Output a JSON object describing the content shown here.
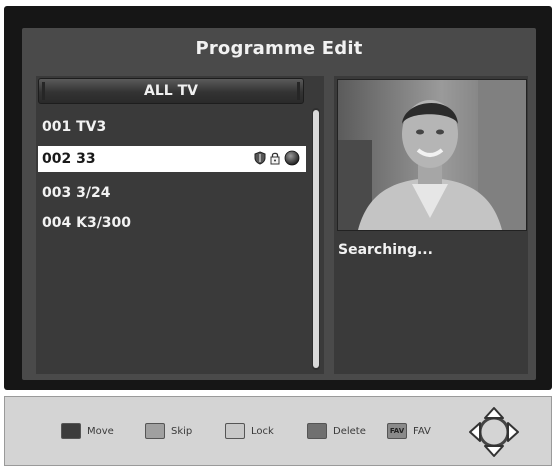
{
  "screen": {
    "title": "Programme Edit"
  },
  "channel_list": {
    "group_label": "ALL TV",
    "selected_index": 1,
    "items": [
      {
        "label": "001 TV3"
      },
      {
        "label": "002 33"
      },
      {
        "label": "003 3/24"
      },
      {
        "label": "004 K3/300"
      }
    ]
  },
  "channel_icons": [
    "shield-icon",
    "lock-icon",
    "globe-icon"
  ],
  "preview": {
    "status": "Searching..."
  },
  "legend": {
    "items": [
      {
        "label": "Move",
        "color": "#3c3c3c",
        "swatch_text": ""
      },
      {
        "label": "Skip",
        "color": "#a0a0a0",
        "swatch_text": ""
      },
      {
        "label": "Lock",
        "color": "#c8c8c8",
        "swatch_text": ""
      },
      {
        "label": "Delete",
        "color": "#707070",
        "swatch_text": ""
      },
      {
        "label": "FAV",
        "color": "#8a8a8a",
        "swatch_text": "FAV"
      }
    ]
  },
  "colors": {
    "frame": "#161616",
    "panel": "#3a3a3a",
    "selected_row": "#ffffff",
    "legend_bar": "#d4d4d4"
  }
}
